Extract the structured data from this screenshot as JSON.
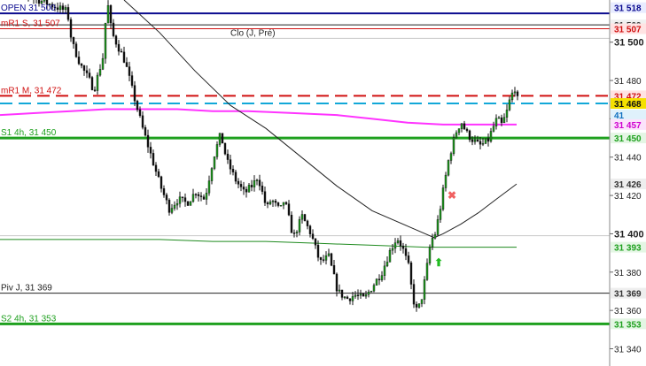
{
  "chart_data": {
    "type": "candlestick",
    "title": "",
    "xlabel": "",
    "ylabel": "",
    "ylim": [
      31331,
      31522
    ],
    "y_ticks": [
      "31 340",
      "31 360",
      "31 380",
      "31 400",
      "31 420",
      "31 440",
      "31 460",
      "31 480",
      "31 500"
    ],
    "grid": false,
    "price_scale_position": "right",
    "levels": [
      {
        "value": 31515,
        "label": "OPEN 31 500",
        "tag": "31 518",
        "color": "#0a0a8f",
        "style": "solid",
        "width": 2
      },
      {
        "value": 31509,
        "label": "",
        "tag": "31 509",
        "color": "#222222",
        "style": "solid",
        "width": 1
      },
      {
        "value": 31507,
        "label": "mR1 S, 31 507",
        "tag": "31 507",
        "color": "#d01010",
        "style": "solid",
        "width": 1
      },
      {
        "value": 31502,
        "label": "Clo (J, Pré)",
        "tag": "",
        "color": "#c8c8c8",
        "style": "solid",
        "width": 1
      },
      {
        "value": 31472,
        "label": "mR1 M, 31 472",
        "tag": "31 472",
        "color": "#d01010",
        "style": "dashed",
        "width": 2
      },
      {
        "value": 31468,
        "label": "",
        "tag": "31 468",
        "color": "#12a8d8",
        "style": "dashed",
        "width": 2
      },
      {
        "value": 31450,
        "label": "S1 4h, 31 450",
        "tag": "31 450",
        "color": "#1ea01e",
        "style": "solid",
        "width": 3
      },
      {
        "value": 31399,
        "label": "",
        "tag": "",
        "color": "#c8c8c8",
        "style": "solid",
        "width": 1
      },
      {
        "value": 31369,
        "label": "Piv J, 31 369",
        "tag": "31 369",
        "color": "#222222",
        "style": "solid",
        "width": 1
      },
      {
        "value": 31353,
        "label": "S2 4h, 31 353",
        "tag": "31 353",
        "color": "#1ea01e",
        "style": "solid",
        "width": 3
      }
    ],
    "price_tags": [
      {
        "value": 31518,
        "text": "31 518",
        "color": "#0a0a8f",
        "bg": "#e8ecff"
      },
      {
        "value": 31509,
        "text": "31 509",
        "color": "#333333",
        "bg": "#f0f0f0"
      },
      {
        "value": 31507,
        "text": "31 507",
        "color": "#d01010",
        "bg": "#ffe3e3"
      },
      {
        "value": 31472,
        "text": "31 472",
        "color": "#d01010",
        "bg": "#ffe3e3"
      },
      {
        "value": 31468,
        "text": "31 468",
        "color": "#111111",
        "bg": "#f5e000"
      },
      {
        "value": 31462,
        "text": "41",
        "color": "#1070c0",
        "bg": "#dff1fb"
      },
      {
        "value": 31457,
        "text": "31 457",
        "color": "#d000d0",
        "bg": "#fbe3fb"
      },
      {
        "value": 31450,
        "text": "31 450",
        "color": "#1ea01e",
        "bg": "#e4f6e4"
      },
      {
        "value": 31426,
        "text": "31 426",
        "color": "#333333",
        "bg": "#eeeeee"
      },
      {
        "value": 31393,
        "text": "31 393",
        "color": "#1ea01e",
        "bg": "#e4f6e4"
      },
      {
        "value": 31369,
        "text": "31 369",
        "color": "#333333",
        "bg": "#eeeeee"
      },
      {
        "value": 31353,
        "text": "31 353",
        "color": "#1ea01e",
        "bg": "#e4f6e4"
      }
    ],
    "moving_averages": [
      {
        "color": "#ff33ff",
        "width": 2,
        "x": [
          0,
          40,
          80,
          120,
          160,
          200,
          240,
          280,
          330,
          380,
          420,
          460,
          500,
          540,
          560,
          583
        ],
        "y": [
          31462,
          31463,
          31464,
          31465,
          31465,
          31465,
          31464,
          31464,
          31463,
          31462,
          31460,
          31458,
          31457,
          31457,
          31457,
          31457
        ]
      },
      {
        "color": "#222222",
        "width": 1,
        "x": [
          140,
          180,
          220,
          260,
          300,
          340,
          380,
          420,
          460,
          490,
          500,
          520,
          540,
          560,
          583
        ],
        "y": [
          31522,
          31505,
          31485,
          31467,
          31455,
          31440,
          31425,
          31412,
          31404,
          31398,
          31400,
          31405,
          31411,
          31418,
          31426
        ]
      },
      {
        "color": "#1e8a1e",
        "width": 1,
        "x": [
          0,
          60,
          120,
          180,
          240,
          300,
          360,
          420,
          480,
          540,
          583
        ],
        "y": [
          31397,
          31397,
          31397,
          31397,
          31396,
          31396,
          31395,
          31394,
          31393,
          31393,
          31393
        ]
      }
    ],
    "price_path": {
      "x": [
        0,
        75,
        80,
        90,
        100,
        105,
        115,
        120,
        125,
        140,
        150,
        160,
        170,
        180,
        190,
        200,
        210,
        220,
        230,
        240,
        248,
        255,
        265,
        275,
        285,
        290,
        300,
        305,
        315,
        320,
        330,
        340,
        350,
        360,
        370,
        380,
        390,
        400,
        410,
        420,
        430,
        440,
        447,
        453,
        460,
        465,
        470,
        475,
        480,
        485,
        490,
        495,
        500,
        505,
        510,
        515,
        520,
        525,
        530,
        540,
        545,
        550,
        555,
        560,
        565,
        570,
        575,
        580,
        583
      ],
      "y": [
        31530,
        31516,
        31500,
        31488,
        31480,
        31475,
        31492,
        31522,
        31505,
        31490,
        31472,
        31455,
        31440,
        31425,
        31413,
        31418,
        31416,
        31422,
        31418,
        31440,
        31452,
        31438,
        31428,
        31421,
        31426,
        31430,
        31413,
        31418,
        31412,
        31418,
        31398,
        31409,
        31400,
        31385,
        31388,
        31370,
        31366,
        31368,
        31366,
        31373,
        31380,
        31392,
        31398,
        31393,
        31383,
        31366,
        31359,
        31367,
        31380,
        31396,
        31400,
        31411,
        31425,
        31438,
        31447,
        31455,
        31458,
        31453,
        31450,
        31446,
        31447,
        31449,
        31455,
        31460,
        31457,
        31462,
        31471,
        31476,
        31470
      ]
    },
    "markers": [
      {
        "type": "sell-signal",
        "symbol": "✖",
        "color": "#f06060",
        "x": 510,
        "y": 31420
      },
      {
        "type": "buy-signal",
        "symbol": "⬆",
        "color": "#22bb22",
        "x": 495,
        "y": 31385
      }
    ]
  }
}
